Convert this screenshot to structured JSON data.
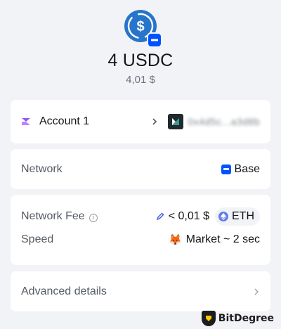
{
  "token": {
    "amount": "4 USDC",
    "fiat": "4,01 $",
    "icon": "usdc-icon",
    "network_badge_icon": "base-network-icon",
    "colors": {
      "usdc": "#2775ca",
      "base": "#0052ff"
    }
  },
  "account": {
    "name": "Account 1",
    "arrow_icon": "chevron-right-icon",
    "destination_blurred": "0x4d5c...a3d8b"
  },
  "network": {
    "label": "Network",
    "value": "Base"
  },
  "fee": {
    "label": "Network Fee",
    "info_icon": "info-icon",
    "value": "< 0,01 $",
    "currency": "ETH"
  },
  "speed": {
    "label": "Speed",
    "value": "Market ~ 2 sec",
    "emoji": "🦊"
  },
  "advanced": {
    "label": "Advanced details"
  },
  "watermark": {
    "text": "BitDegree"
  }
}
